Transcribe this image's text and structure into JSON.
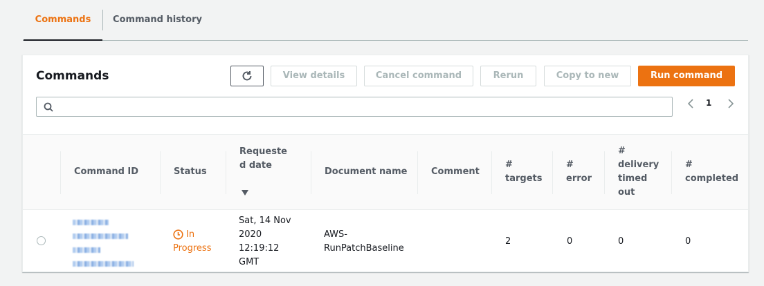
{
  "tabs": [
    {
      "label": "Commands",
      "active": true
    },
    {
      "label": "Command history",
      "active": false
    }
  ],
  "panel": {
    "title": "Commands",
    "buttons": {
      "view_details": "View details",
      "cancel_command": "Cancel command",
      "rerun": "Rerun",
      "copy_to_new": "Copy to new",
      "run_command": "Run command"
    },
    "search": {
      "value": "",
      "placeholder": ""
    },
    "pagination": {
      "current_page": "1"
    }
  },
  "table": {
    "headers": {
      "command_id": "Command ID",
      "status": "Status",
      "requested_date_1": "Requeste",
      "requested_date_2": "d date",
      "document_name": "Document name",
      "comment": "Comment",
      "targets_1": "#",
      "targets_2": "targets",
      "error_1": "#",
      "error_2": "error",
      "delivery_1": "#",
      "delivery_2": "delivery",
      "delivery_3": "timed",
      "delivery_4": "out",
      "completed_1": "#",
      "completed_2": "completed"
    },
    "rows": [
      {
        "status_1": "In",
        "status_2": "Progress",
        "date_1": "Sat, 14 Nov",
        "date_2": "2020",
        "date_3": "12:19:12",
        "date_4": "GMT",
        "document_1": "AWS-",
        "document_2": "RunPatchBaseline",
        "comment": "",
        "targets": "2",
        "error": "0",
        "delivery_timed_out": "0",
        "completed": "0"
      }
    ]
  },
  "colors": {
    "accent": "#ec7211",
    "text": "#16191f",
    "muted": "#545b64",
    "disabled": "#aab7b8"
  }
}
